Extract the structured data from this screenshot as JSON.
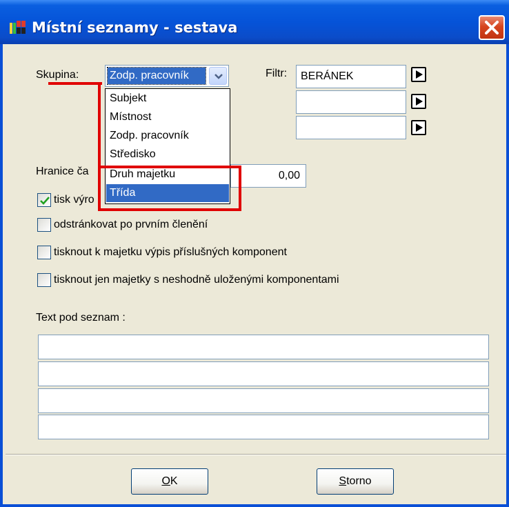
{
  "window": {
    "title": "Místní seznamy - sestava"
  },
  "group": {
    "label": "Skupina:",
    "selected": "Zodp. pracovník",
    "options": [
      "Subjekt",
      "Místnost",
      "Zodp. pracovník",
      "Středisko",
      "Druh majetku",
      "Třída"
    ],
    "highlighted_index": 5
  },
  "filter": {
    "label": "Filtr:",
    "values": [
      "BERÁNEK",
      "",
      ""
    ]
  },
  "limit": {
    "label": "Hranice ča",
    "value": "0,00"
  },
  "checkboxes": [
    {
      "label": "tisk výro",
      "checked": true
    },
    {
      "label": "odstránkovat po prvním členění",
      "checked": false
    },
    {
      "label": "tisknout k majetku výpis příslušných komponent",
      "checked": false
    },
    {
      "label": "tisknout jen majetky s neshodně uloženými komponentami",
      "checked": false
    }
  ],
  "text_below": {
    "label": "Text pod seznam :",
    "lines": [
      "",
      "",
      "",
      ""
    ]
  },
  "buttons": {
    "ok_mnemonic": "O",
    "ok_rest": "K",
    "cancel_mnemonic": "S",
    "cancel_rest": "torno"
  },
  "colors": {
    "titlebar": "#0553d8",
    "selection": "#316ac5",
    "annotation": "#e00000",
    "dialog_bg": "#ece9d8"
  }
}
